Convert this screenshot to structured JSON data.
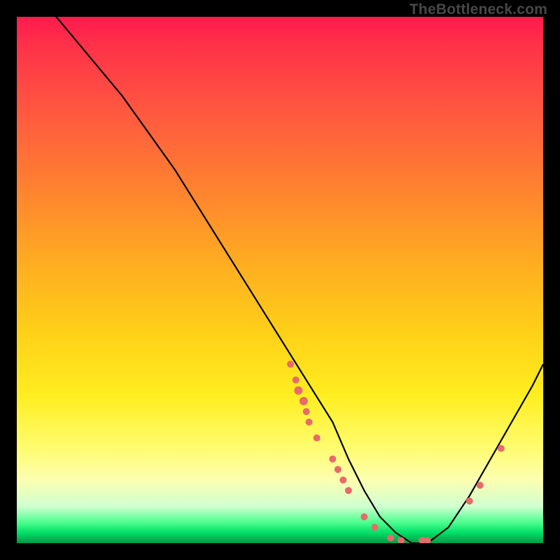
{
  "attribution": "TheBottleneck.com",
  "chart_data": {
    "type": "line",
    "title": "",
    "xlabel": "",
    "ylabel": "",
    "xlim": [
      0,
      100
    ],
    "ylim": [
      0,
      100
    ],
    "curve": {
      "name": "bottleneck-curve",
      "x": [
        0,
        5,
        10,
        15,
        20,
        25,
        30,
        35,
        40,
        45,
        50,
        55,
        60,
        63,
        66,
        69,
        72,
        75,
        78,
        82,
        86,
        90,
        94,
        98,
        100
      ],
      "y": [
        108,
        103,
        97,
        91,
        85,
        78,
        71,
        63,
        55,
        47,
        39,
        31,
        23,
        16,
        10,
        5,
        2,
        0,
        0,
        3,
        9,
        16,
        23,
        30,
        34
      ]
    },
    "markers": {
      "name": "data-points",
      "color": "#e96a6a",
      "points": [
        {
          "x": 52,
          "y": 34,
          "r": 5
        },
        {
          "x": 53,
          "y": 31,
          "r": 5
        },
        {
          "x": 53.5,
          "y": 29,
          "r": 6
        },
        {
          "x": 54.5,
          "y": 27,
          "r": 6
        },
        {
          "x": 55,
          "y": 25,
          "r": 5
        },
        {
          "x": 55.5,
          "y": 23,
          "r": 5
        },
        {
          "x": 57,
          "y": 20,
          "r": 5
        },
        {
          "x": 60,
          "y": 16,
          "r": 5
        },
        {
          "x": 61,
          "y": 14,
          "r": 5
        },
        {
          "x": 62,
          "y": 12,
          "r": 5
        },
        {
          "x": 63,
          "y": 10,
          "r": 5
        },
        {
          "x": 66,
          "y": 5,
          "r": 5
        },
        {
          "x": 68,
          "y": 3,
          "r": 5
        },
        {
          "x": 71,
          "y": 1,
          "r": 5
        },
        {
          "x": 73,
          "y": 0.5,
          "r": 5
        },
        {
          "x": 77,
          "y": 0.5,
          "r": 5
        },
        {
          "x": 78,
          "y": 0.5,
          "r": 5
        },
        {
          "x": 86,
          "y": 8,
          "r": 5
        },
        {
          "x": 88,
          "y": 11,
          "r": 5
        },
        {
          "x": 92,
          "y": 18,
          "r": 5
        }
      ]
    }
  }
}
